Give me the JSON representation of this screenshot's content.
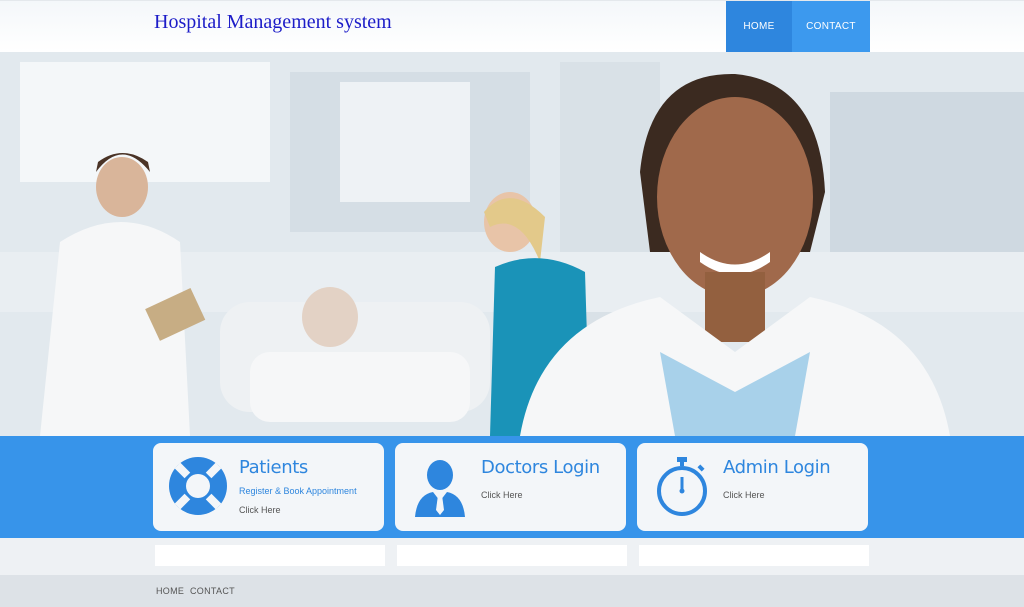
{
  "header": {
    "title": "Hospital Management system",
    "nav": {
      "home": "HOME",
      "contact": "CONTACT"
    }
  },
  "colors": {
    "accent": "#3794ea",
    "title": "#1c1cc8",
    "card_bg": "#f3f6f9"
  },
  "cards": [
    {
      "title": "Patients",
      "subtitle": "Register & Book Appointment",
      "link": "Click Here",
      "icon": "lifebuoy-icon"
    },
    {
      "title": "Doctors Login",
      "link": "Click Here",
      "icon": "doctor-icon"
    },
    {
      "title": "Admin Login",
      "link": "Click Here",
      "icon": "stopwatch-icon"
    }
  ],
  "footer": {
    "home": "HOME",
    "contact": "CONTACT"
  }
}
